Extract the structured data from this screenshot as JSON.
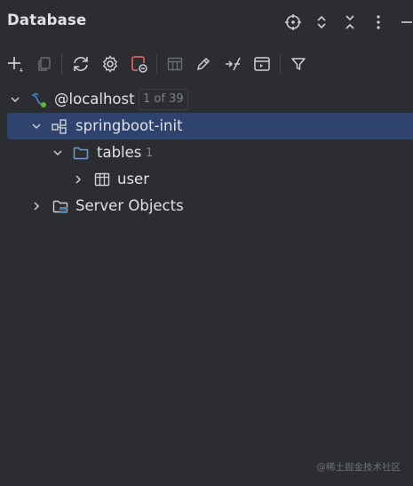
{
  "panel": {
    "title": "Database"
  },
  "tree": {
    "host": {
      "label": "@localhost",
      "badge": "1 of 39"
    },
    "schema": {
      "label": "springboot-init"
    },
    "tables_folder": {
      "label": "tables",
      "count": "1"
    },
    "table": {
      "label": "user"
    },
    "server_objects": {
      "label": "Server Objects"
    }
  },
  "watermark": "@稀土掘金技术社区",
  "colors": {
    "background": "#2b2d30",
    "selection": "#2e436e",
    "folder_icon": "#6e9ed6",
    "red_accent": "#e0605a",
    "mysql_blue": "#3f86c6",
    "connected_green": "#5fb832"
  }
}
